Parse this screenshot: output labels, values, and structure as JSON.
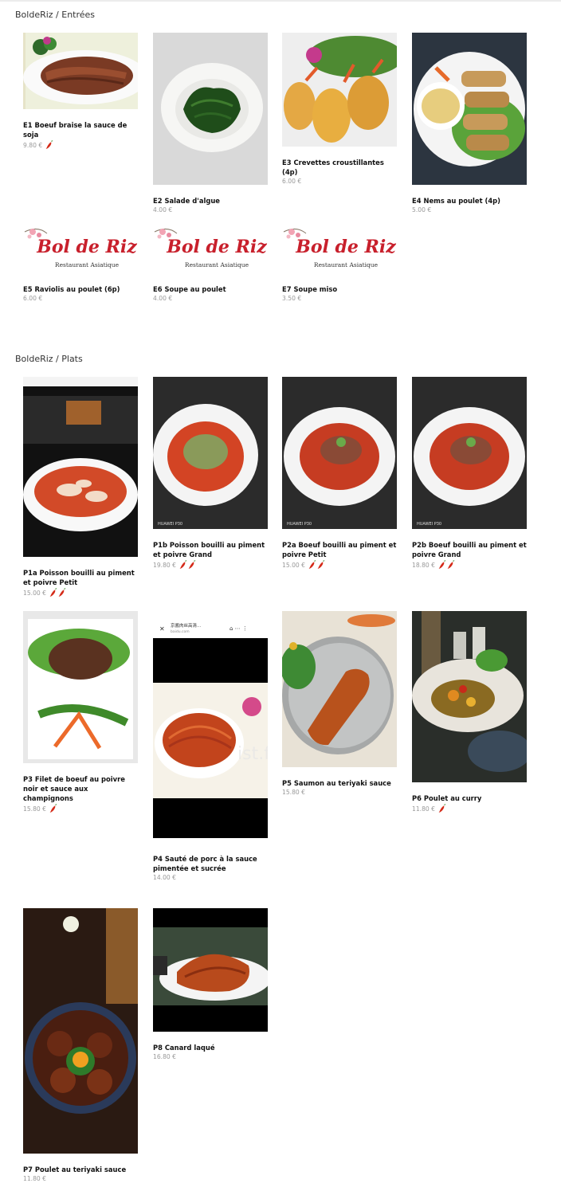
{
  "sections": [
    {
      "title": "BoldeRiz / Entrées"
    },
    {
      "title": "BoldeRiz / Plats"
    }
  ],
  "logo": {
    "name": "Bol de Riz",
    "subtitle": "Restaurant Asiatique"
  },
  "phone_ui": {
    "site": "baidu.com",
    "title": "京酱肉丝高清..."
  },
  "watermark": "ist.fr",
  "items": [
    {
      "name": "E1 Boeuf braise la sauce de soja",
      "price": "9.80 €",
      "spicy": 1
    },
    {
      "name": "E2 Salade d'algue",
      "price": "4.00 €",
      "spicy": 0
    },
    {
      "name": "E3 Crevettes croustillantes (4p)",
      "price": "6.00 €",
      "spicy": 0
    },
    {
      "name": "E4 Nems au poulet (4p)",
      "price": "5.00 €",
      "spicy": 0
    },
    {
      "name": "E5 Raviolis au poulet (6p)",
      "price": "6.00 €",
      "spicy": 0
    },
    {
      "name": "E6 Soupe au poulet",
      "price": "4.00 €",
      "spicy": 0
    },
    {
      "name": "E7 Soupe miso",
      "price": "3.50 €",
      "spicy": 0
    },
    {
      "name": "P1a Poisson bouilli au piment et poivre Petit",
      "price": "15.00 €",
      "spicy": 2
    },
    {
      "name": "P1b Poisson bouilli au piment et poivre Grand",
      "price": "19.80 €",
      "spicy": 2
    },
    {
      "name": "P2a Boeuf bouilli au piment et poivre Petit",
      "price": "15.00 €",
      "spicy": 2
    },
    {
      "name": "P2b Boeuf bouilli au piment et poivre Grand",
      "price": "18.80 €",
      "spicy": 2
    },
    {
      "name": "P3 Filet de boeuf au poivre noir et sauce aux champignons",
      "price": "15.80 €",
      "spicy": 1
    },
    {
      "name": "P4 Sauté de porc à la sauce pimentée et sucrée",
      "price": "14.00 €",
      "spicy": 0
    },
    {
      "name": "P5 Saumon au teriyaki sauce",
      "price": "15.80 €",
      "spicy": 0
    },
    {
      "name": "P6 Poulet au curry",
      "price": "11.80 €",
      "spicy": 1
    },
    {
      "name": "P7 Poulet au teriyaki sauce",
      "price": "11.80 €",
      "spicy": 0
    },
    {
      "name": "P8 Canard laqué",
      "price": "16.80 €",
      "spicy": 0
    }
  ]
}
